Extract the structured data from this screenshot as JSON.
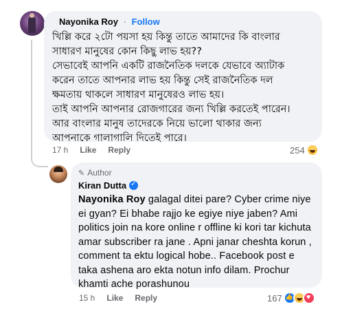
{
  "comment1": {
    "author": "Nayonika Roy",
    "separator": "·",
    "follow_label": "Follow",
    "text": "খিল্লি করে ২টো পয়সা হয় কিন্তু তাতে আমাদের কি বাংলার\nসাধারণ মানুষের কোন কিছু লাভ হয়??\nসেভাবেই আপনি একটি রাজনৈতিক দলকে যেভাবে অ্যাটাক\nকরেন তাতে আপনার লাভ হয় কিন্তু সেই রাজনৈতিক দল\nক্ষমতায় থাকলে সাধারণ মানুষেরও লাভ হয়।\nতাই আপনি আপনার রোজগারের জন্য খিল্লি করতেই পারেন।\nআর বাংলার মানুষ তাদেরকে নিয়ে ভালো থাকার জন্য\nআপনাকে গালাগালি দিতেই পারে।",
    "time": "17 h",
    "like_label": "Like",
    "reply_label": "Reply",
    "reaction_count": "254",
    "reactions": [
      "haha-icon"
    ]
  },
  "comment2": {
    "badge_label": "Author",
    "badge_icon": "pen-icon",
    "author": "Kiran Dutta",
    "verified_icon": "verified-badge-icon",
    "mention": "Nayonika Roy",
    "text": " galagal ditei pare? Cyber crime niye ei gyan? Ei bhabe rajjo ke egiye niye jaben? Ami politics join na kore online r offline ki kori tar kichuta amar subscriber ra jane . Apni janar cheshta korun , comment ta ektu logical hobe.. Facebook post e taka ashena aro ekta notun info dilam. Prochur khamti ache porashunou",
    "time": "15 h",
    "like_label": "Like",
    "reply_label": "Reply",
    "reaction_count": "167",
    "reactions": [
      "like-icon",
      "haha-icon",
      "love-icon"
    ]
  },
  "colors": {
    "bubble_bg": "#f0f2f5",
    "link_blue": "#1877f2",
    "meta_gray": "#65676b",
    "thread_line": "#ced0d4"
  }
}
